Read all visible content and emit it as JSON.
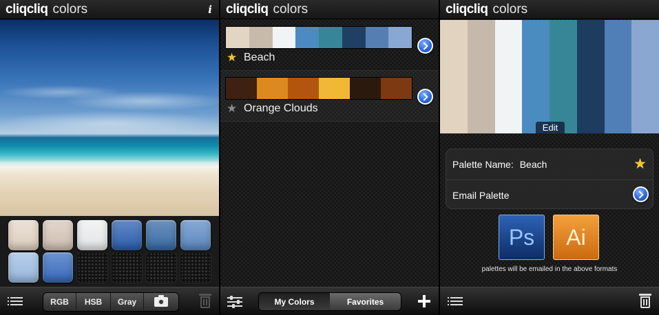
{
  "app": {
    "logo_bold": "cliqcliq",
    "logo_light": "colors",
    "info_icon": "i"
  },
  "screen1": {
    "swatches": [
      {
        "color": "#e6d8c8",
        "empty": false
      },
      {
        "color": "#d8c8b9",
        "empty": false
      },
      {
        "color": "#eef1f1",
        "empty": false
      },
      {
        "color": "#2e62b2",
        "empty": false
      },
      {
        "color": "#3b6ea9",
        "empty": false
      },
      {
        "color": "#5f8ec8",
        "empty": false
      },
      {
        "color": "#9fc0e6",
        "empty": false
      },
      {
        "color": "#3a6fc2",
        "empty": false
      },
      {
        "color": "",
        "empty": true
      },
      {
        "color": "",
        "empty": true
      },
      {
        "color": "",
        "empty": true
      },
      {
        "color": "",
        "empty": true
      }
    ],
    "toolbar": {
      "rgb": "RGB",
      "hsb": "HSB",
      "gray": "Gray"
    }
  },
  "screen2": {
    "palettes": [
      {
        "name": "Beach",
        "favorite": true,
        "colors": [
          "#e2d5c4",
          "#c7baab",
          "#f0f4f4",
          "#4b8bc1",
          "#378598",
          "#1f4063",
          "#557fb3",
          "#89a7d3"
        ]
      },
      {
        "name": "Orange Clouds",
        "favorite": false,
        "colors": [
          "#3e2110",
          "#dc8a1e",
          "#b2560f",
          "#f1b835",
          "#2c190e",
          "#7d3a12"
        ]
      }
    ],
    "tabs": {
      "my_colors": "My Colors",
      "favorites": "Favorites"
    }
  },
  "screen3": {
    "colors": [
      "#e2d3c0",
      "#c5b9ac",
      "#f0f4f4",
      "#4a8bc0",
      "#378698",
      "#1c3c60",
      "#4f7fb6",
      "#8aa7d1"
    ],
    "edit_label": "Edit",
    "palette_name_label": "Palette Name:",
    "palette_name_value": "Beach",
    "email_label": "Email Palette",
    "ps_label": "Ps",
    "ai_label": "Ai",
    "formats_note": "palettes will be emailed in the above formats"
  }
}
